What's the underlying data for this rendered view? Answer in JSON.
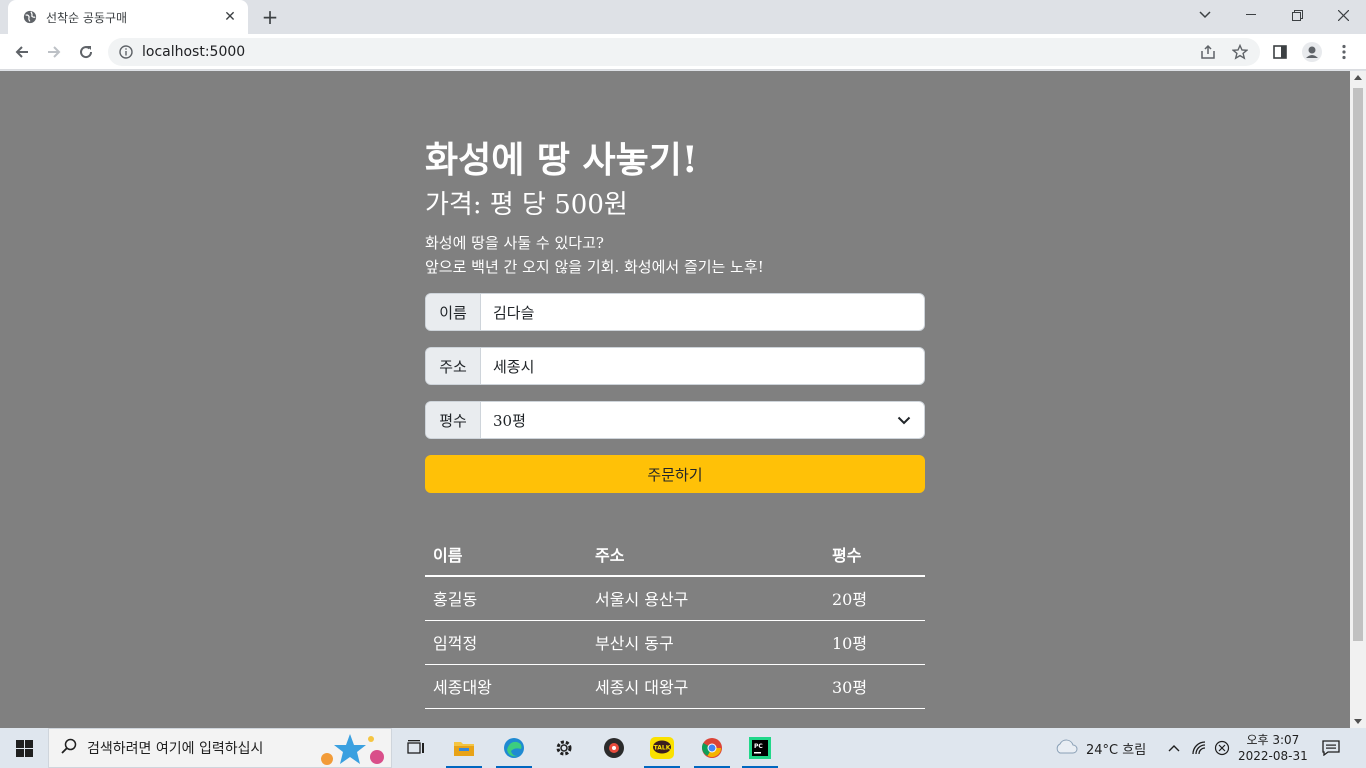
{
  "browser": {
    "tab_title": "선착순 공동구매",
    "url": "localhost:5000"
  },
  "page": {
    "title": "화성에 땅 사놓기!",
    "price": "가격: 평 당 500원",
    "desc_line1": "화성에 땅을 사둘 수 있다고?",
    "desc_line2": "앞으로 백년 간 오지 않을 기회. 화성에서 즐기는 노후!"
  },
  "form": {
    "name_label": "이름",
    "name_value": "김다슬",
    "address_label": "주소",
    "address_value": "세종시",
    "size_label": "평수",
    "size_value": "30평",
    "order_button": "주문하기"
  },
  "table": {
    "headers": [
      "이름",
      "주소",
      "평수"
    ],
    "rows": [
      [
        "홍길동",
        "서울시 용산구",
        "20평"
      ],
      [
        "임꺽정",
        "부산시 동구",
        "10평"
      ],
      [
        "세종대왕",
        "세종시 대왕구",
        "30평"
      ]
    ]
  },
  "taskbar": {
    "search_placeholder": "검색하려면 여기에 입력하십시",
    "weather": "24°C  흐림",
    "time": "오후 3:07",
    "date": "2022-08-31"
  },
  "colors": {
    "page_bg": "#808080",
    "order_button": "#ffc107"
  }
}
